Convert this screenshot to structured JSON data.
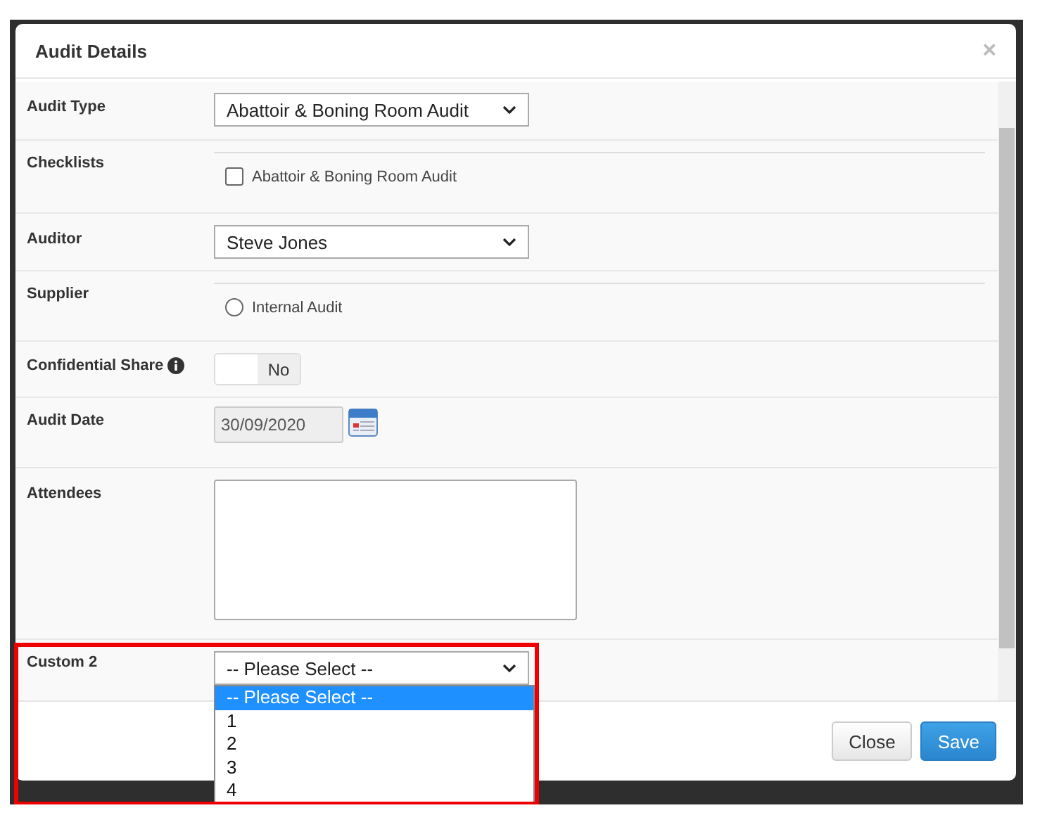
{
  "dialog": {
    "title": "Audit Details",
    "close": "×"
  },
  "fields": [
    {
      "kind": "select",
      "label": "Audit Type",
      "value": "Abattoir & Boning Room Audit"
    },
    {
      "kind": "checkbox",
      "label": "Checklists",
      "option": "Abattoir & Boning Room Audit",
      "checked": false
    },
    {
      "kind": "select",
      "label": "Auditor",
      "value": "Steve Jones"
    },
    {
      "kind": "radio",
      "label": "Supplier",
      "option": "Internal Audit",
      "selected": false
    },
    {
      "kind": "toggle",
      "label": "Confidential Share",
      "state_text": "No",
      "on": false
    },
    {
      "kind": "date",
      "label": "Audit Date",
      "value": "30/09/2020"
    },
    {
      "kind": "textarea",
      "label": "Attendees"
    },
    {
      "kind": "dropdown",
      "label": "Custom 2",
      "value": "-- Please Select --",
      "options": [
        {
          "label": "-- Please Select --",
          "selected": true
        },
        {
          "label": "1",
          "selected": false
        },
        {
          "label": "2",
          "selected": false
        },
        {
          "label": "3",
          "selected": false
        },
        {
          "label": "4",
          "selected": false
        }
      ]
    }
  ],
  "buttons": [
    {
      "label": "Close",
      "kind": "default"
    },
    {
      "label": "Save",
      "kind": "primary"
    }
  ]
}
